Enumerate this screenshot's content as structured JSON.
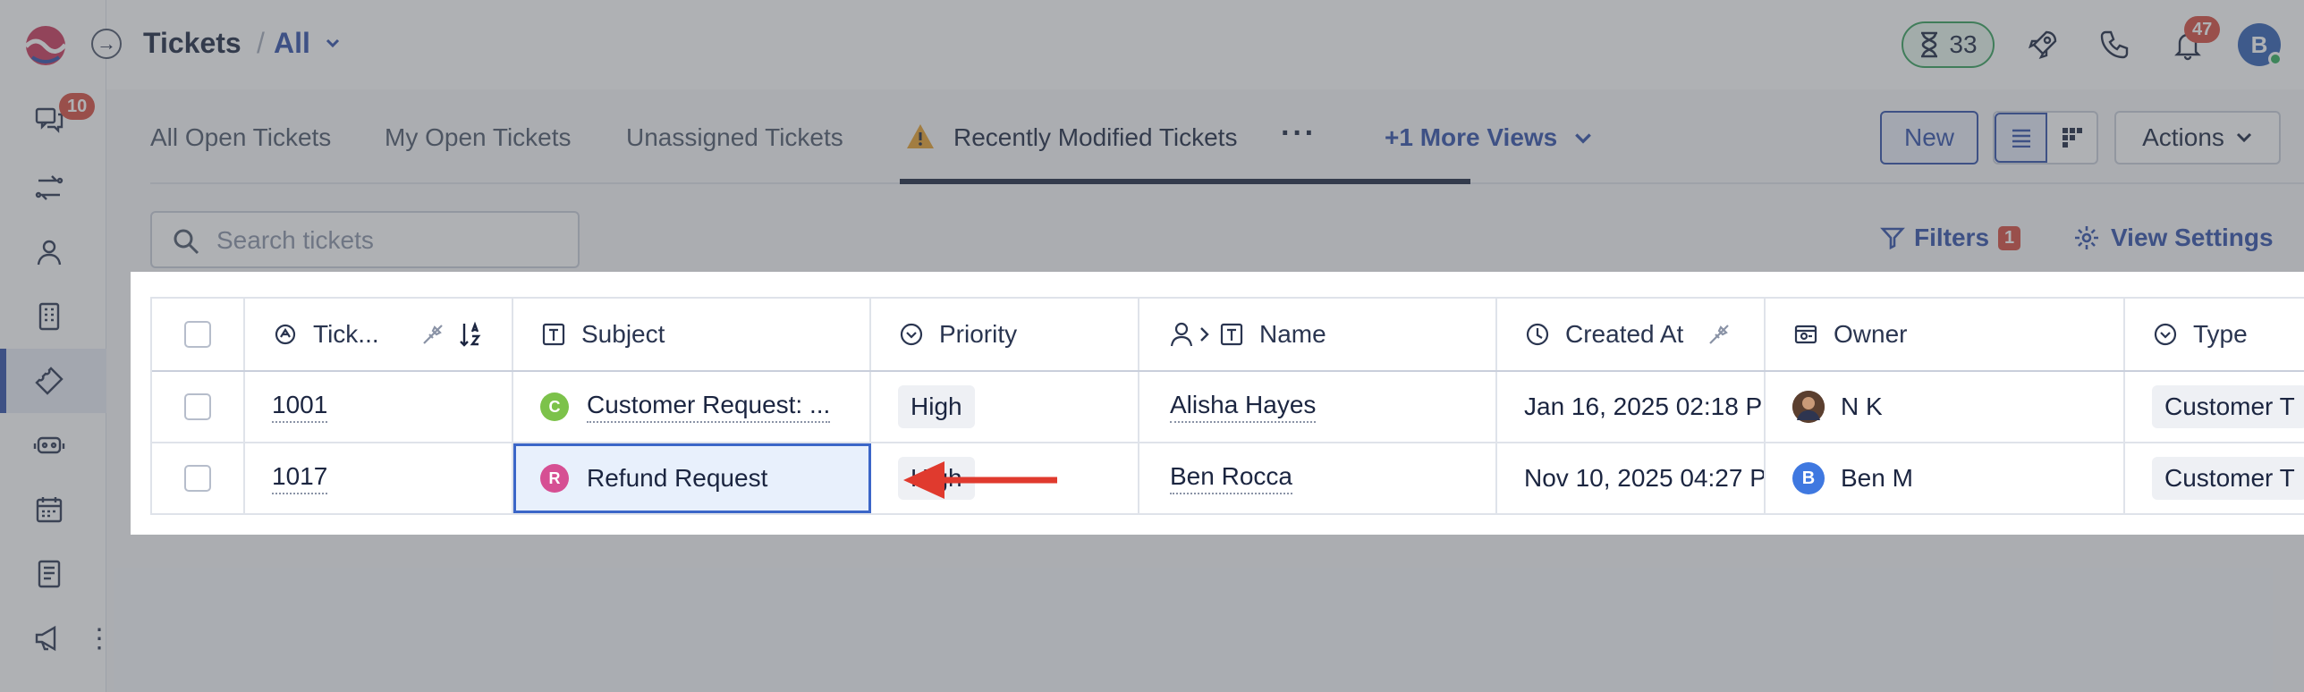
{
  "header": {
    "title": "Tickets",
    "separator": "/",
    "view_selector": "All",
    "timer_count": "33",
    "notifications_count": "47",
    "avatar_initial": "B"
  },
  "sidebar": {
    "conversations_badge": "10"
  },
  "tabs": {
    "items": [
      {
        "label": "All Open Tickets"
      },
      {
        "label": "My Open Tickets"
      },
      {
        "label": "Unassigned Tickets"
      },
      {
        "label": "Recently Modified Tickets"
      }
    ],
    "more_views": "+1 More Views"
  },
  "toolbar": {
    "new_label": "New",
    "actions_label": "Actions",
    "search_placeholder": "Search tickets",
    "filters_label": "Filters",
    "filters_count": "1",
    "view_settings_label": "View Settings"
  },
  "table": {
    "columns": [
      "Tick...",
      "Subject",
      "Priority",
      "Name",
      "Created At",
      "Owner",
      "Type"
    ],
    "rows": [
      {
        "id": "1001",
        "subject_initial": "C",
        "subject": "Customer Request: ...",
        "priority": "High",
        "name": "Alisha Hayes",
        "created_at": "Jan 16, 2025 02:18 P",
        "owner": "N K",
        "type": "Customer T"
      },
      {
        "id": "1017",
        "subject_initial": "R",
        "subject": "Refund Request",
        "priority": "High",
        "name": "Ben Rocca",
        "created_at": "Nov 10, 2025 04:27 P",
        "owner_initial": "B",
        "owner": "Ben M",
        "type": "Customer T"
      }
    ]
  },
  "colors": {
    "accent": "#2f4fa8",
    "badge": "#d64b3d",
    "timer_green": "#33a05a",
    "subject_c": "#7cc24a",
    "subject_r": "#d64f93",
    "arrow": "#e03a2e",
    "selection": "#3b66c8"
  }
}
